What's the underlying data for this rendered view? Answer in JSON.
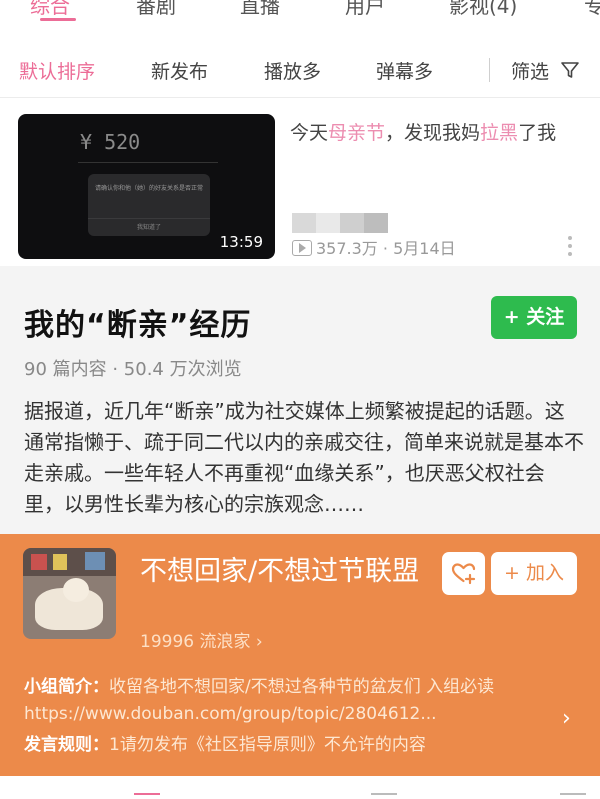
{
  "top_tabs": [
    {
      "label": "综合",
      "active": true
    },
    {
      "label": "番剧",
      "active": false
    },
    {
      "label": "直播",
      "active": false
    },
    {
      "label": "用户",
      "active": false
    },
    {
      "label": "影视(4)",
      "active": false
    },
    {
      "label": "专",
      "active": false
    }
  ],
  "sort_bar": {
    "options": [
      "默认排序",
      "新发布",
      "播放多",
      "弹幕多"
    ],
    "filter_label": "筛选",
    "filter_icon": "filter-funnel-icon"
  },
  "video": {
    "thumbnail": {
      "amount": "¥ 520",
      "dialog_text": "请确认你和他（她）的好友关系是否正常",
      "dialog_button": "我知道了",
      "duration": "13:59"
    },
    "title_parts": [
      "今天",
      "母亲节",
      "，发现我妈",
      "拉黑",
      "了我"
    ],
    "views": "357.3万",
    "date": "5月14日"
  },
  "topic": {
    "title": "我的“断亲”经历",
    "follow_label": "+ 关注",
    "stats": "90 篇内容 · 50.4 万次浏览",
    "description": "据报道，近几年“断亲”成为社交媒体上频繁被提起的话题。这通常指懒于、疏于同二代以内的亲戚交往，简单来说就是基本不走亲戚。一些年轻人不再重视“血缘关系”，也厌恶父权社会里，以男性长辈为核心的宗族观念……"
  },
  "group": {
    "name": "不想回家/不想过节联盟",
    "members": "19996 流浪家 ›",
    "join_label": "+ 加入",
    "intro_label": "小组简介：",
    "intro_text": "收留各地不想回家/不想过各种节的盆友们 入组必读https://www.douban.com/group/topic/2804612...",
    "rule_label": "发言规则：",
    "rule_text": "1请勿发布《社区指导原则》不允许的内容",
    "colors": {
      "background": "#ec8a4a"
    }
  },
  "colors": {
    "accent_pink": "#ec6d97",
    "follow_green": "#2ebb4e"
  }
}
